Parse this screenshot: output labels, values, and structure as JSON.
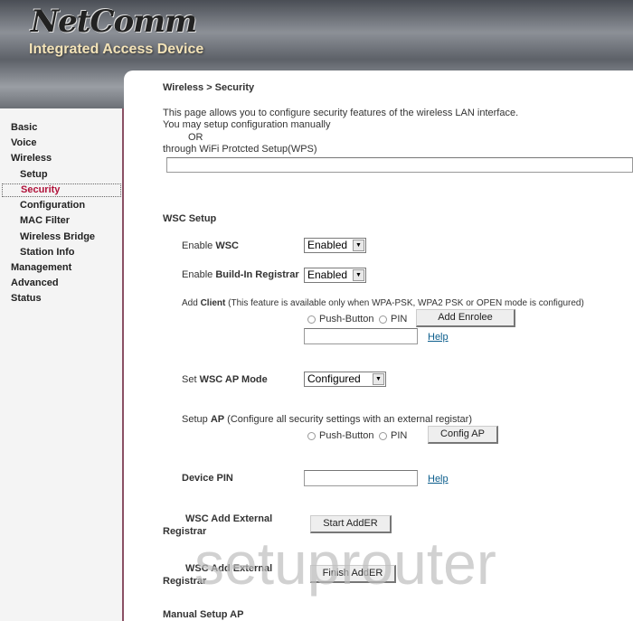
{
  "header": {
    "brand": "NetComm",
    "tagline": "Integrated Access Device"
  },
  "sidebar": {
    "items": [
      {
        "label": "Basic"
      },
      {
        "label": "Voice"
      },
      {
        "label": "Wireless"
      },
      {
        "label": "Setup"
      },
      {
        "label": "Security"
      },
      {
        "label": "Configuration"
      },
      {
        "label": "MAC Filter"
      },
      {
        "label": "Wireless Bridge"
      },
      {
        "label": "Station Info"
      },
      {
        "label": "Management"
      },
      {
        "label": "Advanced"
      },
      {
        "label": "Status"
      }
    ]
  },
  "main": {
    "breadcrumb": "Wireless > Security",
    "desc1": "This page allows you to configure security features of the wireless LAN interface.",
    "desc2": "You may setup configuration manually",
    "desc3": "OR",
    "desc4": "through WiFi Protcted Setup(WPS)",
    "wsc_setup": "WSC Setup",
    "enable_wsc_pre": "Enable ",
    "enable_wsc_b": "WSC",
    "enable_wsc_value": "Enabled",
    "registrar_pre": "Enable ",
    "registrar_b": "Build-In Registrar",
    "registrar_value": "Enabled",
    "client_pre": "Add ",
    "client_b": "Client",
    "client_note": " (This feature is available only when WPA-PSK, WPA2 PSK or OPEN mode is configured)",
    "push_button": "Push-Button",
    "pin": "PIN",
    "add_enrolee": "Add Enrolee",
    "help": "Help",
    "ap_mode_pre": "Set ",
    "ap_mode_b": "WSC AP Mode",
    "ap_mode_value": "Configured",
    "setup_ap_pre": "Setup ",
    "setup_ap_b": "AP",
    "setup_ap_note": " (Configure all security settings with an external registar)",
    "config_ap": "Config AP",
    "device_pin": "Device PIN",
    "ext_reg_1a": "WSC Add External",
    "ext_reg_1b": "Registrar",
    "start_adder": "Start AddER",
    "ext_reg_2a": "WSC Add External",
    "ext_reg_2b": "Registrar",
    "finish_adder": "Finish AddER",
    "manual_setup": "Manual Setup AP"
  },
  "watermark": "setuprouter"
}
